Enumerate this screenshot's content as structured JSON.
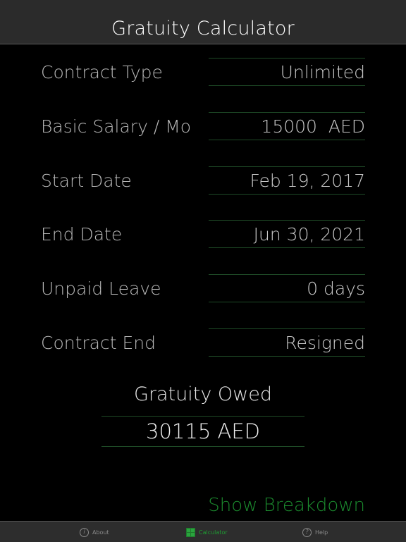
{
  "header": {
    "title": "Gratuity Calculator"
  },
  "form": {
    "contract_type": {
      "label": "Contract Type",
      "value": "Unlimited"
    },
    "basic_salary": {
      "label": "Basic Salary / Mo",
      "value": "15000  AED"
    },
    "start_date": {
      "label": "Start Date",
      "value": "Feb 19, 2017"
    },
    "end_date": {
      "label": "End Date",
      "value": "Jun 30, 2021"
    },
    "unpaid_leave": {
      "label": "Unpaid Leave",
      "value": "0 days"
    },
    "contract_end": {
      "label": "Contract End",
      "value": "Resigned"
    }
  },
  "result": {
    "title": "Gratuity Owed",
    "value": "30115 AED"
  },
  "actions": {
    "show_breakdown": "Show Breakdown"
  },
  "tabbar": {
    "tabs": [
      {
        "label": "About",
        "icon": "info-icon"
      },
      {
        "label": "Calculator",
        "icon": "calculator-icon",
        "active": true
      },
      {
        "label": "Help",
        "icon": "help-icon"
      }
    ]
  },
  "colors": {
    "accent": "#1b8a2e",
    "field_border": "#1e4a26",
    "navbar": "#2b2b2b"
  }
}
